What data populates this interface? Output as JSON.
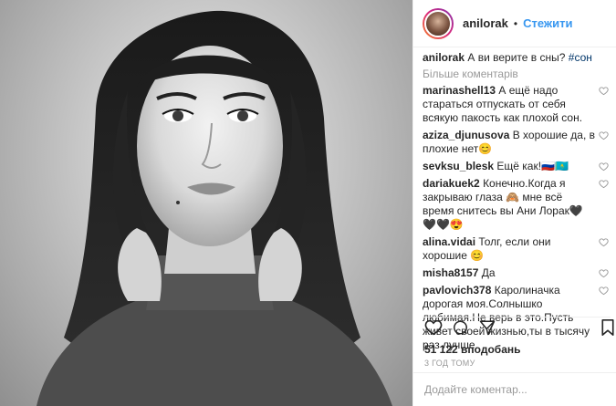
{
  "header": {
    "username": "anilorak",
    "separator": "•",
    "follow_label": "Стежити"
  },
  "caption": {
    "user": "anilorak",
    "text": "А ви верите в сны?",
    "hashtag": "#сон"
  },
  "more_comments_label": "Більше коментарів",
  "comments": [
    {
      "user": "marinashell13",
      "text": "А ещё надо стараться отпускать от себя всякую пакость как плохой сон."
    },
    {
      "user": "aziza_djunusova",
      "text": "В хорошие да, в плохие нет😊"
    },
    {
      "user": "sevksu_blesk",
      "text": "Ещё как!🇷🇺🇰🇿"
    },
    {
      "user": "dariakuek2",
      "text": "Конечно.Когда я закрываю глаза 🙈 мне всё время снитесь вы Ани Лорак🖤🖤🖤😍"
    },
    {
      "user": "alina.vidai",
      "text": "Толг, если они хорошие 😊"
    },
    {
      "user": "misha8157",
      "text": "Да"
    },
    {
      "user": "pavlovich378",
      "text": "Каролиначка дорогая моя.Солнышко любимая.Не верь в это.Пусть живет своей жизнью,ты в тысячу раз лучше."
    }
  ],
  "likes_text": "51 122 вподобань",
  "time_text": "3 ГОД ТОМУ",
  "add_comment_placeholder": "Додайте коментар...",
  "icons": [
    "heart-icon",
    "comment-icon",
    "share-icon",
    "bookmark-icon"
  ]
}
